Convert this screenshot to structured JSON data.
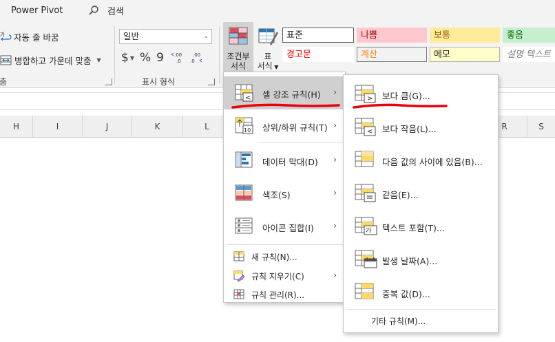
{
  "tabbar": {
    "power_pivot": "Power Pivot",
    "search_label": "검색"
  },
  "alignment": {
    "wrap_text": "자동 줄 바꿈",
    "merge_center": "병합하고 가운데 맞춤",
    "group_label": "맞춤"
  },
  "number": {
    "format_value": "일반",
    "currency": "$",
    "percent": "%",
    "comma": "9",
    "group_label": "표시 형식"
  },
  "styles": {
    "conditional_formatting": [
      "조건부",
      "서식"
    ],
    "format_table": [
      "표",
      "서식"
    ],
    "cells": [
      {
        "label": "표준",
        "bg": "#ffffff",
        "fg": "#222222",
        "border": "#5a5a5a"
      },
      {
        "label": "나쁨",
        "bg": "#ffc7ce",
        "fg": "#9c0006",
        "border": "#ffc7ce"
      },
      {
        "label": "보통",
        "bg": "#ffeb9c",
        "fg": "#9c5700",
        "border": "#ffeb9c"
      },
      {
        "label": "좋음",
        "bg": "#c6efce",
        "fg": "#006100",
        "border": "#c6efce"
      },
      {
        "label": "경고문",
        "bg": "#ffffff",
        "fg": "#ff0000",
        "border": "#ffffff"
      },
      {
        "label": "계산",
        "bg": "#f2f2f2",
        "fg": "#fa7d00",
        "border": "#7f7f7f"
      },
      {
        "label": "메모",
        "bg": "#ffffcc",
        "fg": "#222222",
        "border": "#b2b2b2"
      },
      {
        "label": "설명 텍스트",
        "bg": "#ffffff",
        "fg": "#7f7f7f",
        "border": "#ffffff"
      }
    ]
  },
  "columns": [
    "H",
    "I",
    "J",
    "K",
    "L",
    "R",
    "S"
  ],
  "cf_menu": {
    "items": [
      {
        "label": "셀 강조 규칙(H)",
        "icon": "highlight-cells-rules-icon",
        "submenu": true,
        "highlighted": true
      },
      {
        "label": "상위/하위 규칙(T)",
        "icon": "top-bottom-rules-icon",
        "submenu": true
      },
      {
        "label": "데이터 막대(D)",
        "icon": "data-bars-icon",
        "submenu": true
      },
      {
        "label": "색조(S)",
        "icon": "color-scales-icon",
        "submenu": true
      },
      {
        "label": "아이콘 집합(I)",
        "icon": "icon-sets-icon",
        "submenu": true
      }
    ],
    "small_items": [
      {
        "label": "새 규칙(N)...",
        "icon": "new-rule-icon",
        "submenu": false
      },
      {
        "label": "규칙 지우기(C)",
        "icon": "clear-rules-icon",
        "submenu": true
      },
      {
        "label": "규칙 관리(R)...",
        "icon": "manage-rules-icon",
        "submenu": false
      }
    ]
  },
  "hcr_menu": {
    "items": [
      {
        "label": "보다 큼(G)...",
        "icon": "greater-than-icon"
      },
      {
        "label": "보다 작음(L)...",
        "icon": "less-than-icon"
      },
      {
        "label": "다음 값의 사이에 있음(B)...",
        "icon": "between-icon"
      },
      {
        "label": "같음(E)...",
        "icon": "equal-to-icon"
      },
      {
        "label": "텍스트 포함(T)...",
        "icon": "text-contains-icon"
      },
      {
        "label": "발생 날짜(A)...",
        "icon": "date-occurring-icon"
      },
      {
        "label": "중복 값(D)...",
        "icon": "duplicate-values-icon"
      }
    ],
    "more_rules": "기타 규칙(M)..."
  },
  "colors": {
    "annotation_red": "#e8000b",
    "ribbon_bg": "#f3f3f3",
    "menu_highlight": "#d0d0d0"
  }
}
